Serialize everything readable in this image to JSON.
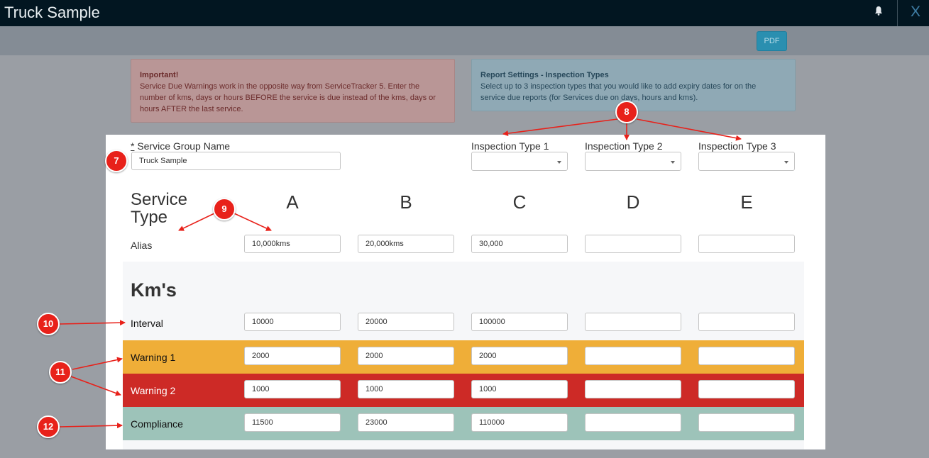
{
  "window": {
    "title": "Truck Sample",
    "close_label": "X"
  },
  "toolbar": {
    "pdf_label": "PDF"
  },
  "alerts": {
    "important_title": "Important!",
    "important_lines": [
      "Service Due Warnings work in the opposite way from ServiceTracker 5. Enter the",
      "number of kms, days or hours BEFORE the service is due instead of the kms, days or",
      "hours AFTER the last service."
    ],
    "report_title": "Report Settings - Inspection Types",
    "report_lines": [
      "Select up to 3 inspection types that you would like to add expiry dates for on the",
      "service due reports (for Services due on days, hours and kms)."
    ]
  },
  "form": {
    "group_name_required": "*",
    "group_name_label": " Service Group Name",
    "group_name_value": "Truck Sample",
    "inspection_labels": [
      "Inspection Type 1",
      "Inspection Type 2",
      "Inspection Type 3"
    ],
    "service_type_heading_line1": "Service",
    "service_type_heading_line2": "Type",
    "columns": [
      "A",
      "B",
      "C",
      "D",
      "E"
    ],
    "alias_label": "Alias",
    "alias_values": [
      "10,000kms",
      "20,000kms",
      "30,000",
      "",
      ""
    ],
    "km_section_title": "Km's",
    "rows": {
      "interval": {
        "label": "Interval",
        "values": [
          "10000",
          "20000",
          "100000",
          "",
          ""
        ]
      },
      "warning1": {
        "label": "Warning 1",
        "values": [
          "2000",
          "2000",
          "2000",
          "",
          ""
        ]
      },
      "warning2": {
        "label": "Warning 2",
        "values": [
          "1000",
          "1000",
          "1000",
          "",
          ""
        ]
      },
      "compliance": {
        "label": "Compliance",
        "values": [
          "11500",
          "23000",
          "110000",
          "",
          ""
        ]
      }
    }
  },
  "annotations": [
    "7",
    "8",
    "9",
    "10",
    "11",
    "12"
  ],
  "colors": {
    "warning1": "#efae38",
    "warning2": "#cd2a26",
    "compliance": "#9dc3b9",
    "annotation": "#e8211a"
  },
  "icons": {
    "notifications": "bell-icon",
    "dropdown": "caret-down-icon"
  }
}
